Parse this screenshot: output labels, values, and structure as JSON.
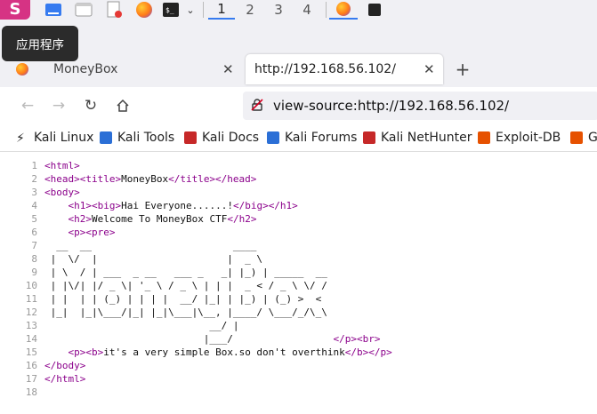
{
  "taskbar": {
    "workspaces": [
      "1",
      "2",
      "3",
      "4"
    ],
    "active_workspace": "1",
    "tooltip": "应用程序"
  },
  "tabs": [
    {
      "title": "MoneyBox",
      "active": false
    },
    {
      "title": "http://192.168.56.102/",
      "active": true
    }
  ],
  "new_tab_label": "+",
  "urlbar": {
    "value": "view-source:http://192.168.56.102/"
  },
  "bookmarks": [
    {
      "label": "Kali Linux",
      "color": "#1e1e1e"
    },
    {
      "label": "Kali Tools",
      "color": "#2b6fd6"
    },
    {
      "label": "Kali Docs",
      "color": "#c62828"
    },
    {
      "label": "Kali Forums",
      "color": "#2b6fd6"
    },
    {
      "label": "Kali NetHunter",
      "color": "#c62828"
    },
    {
      "label": "Exploit-DB",
      "color": "#e65100"
    },
    {
      "label": "G",
      "color": "#e65100"
    }
  ],
  "source_lines": [
    {
      "n": "1",
      "tokens": [
        {
          "t": "tag",
          "v": "<html>"
        }
      ]
    },
    {
      "n": "2",
      "tokens": [
        {
          "t": "tag",
          "v": "<head><title>"
        },
        {
          "t": "txt",
          "v": "MoneyBox"
        },
        {
          "t": "tag",
          "v": "</title></head>"
        }
      ]
    },
    {
      "n": "3",
      "tokens": [
        {
          "t": "tag",
          "v": "<body>"
        }
      ]
    },
    {
      "n": "4",
      "tokens": [
        {
          "t": "txt",
          "v": "    "
        },
        {
          "t": "tag",
          "v": "<h1><big>"
        },
        {
          "t": "txt",
          "v": "Hai Everyone......!"
        },
        {
          "t": "tag",
          "v": "</big></h1>"
        }
      ]
    },
    {
      "n": "5",
      "tokens": [
        {
          "t": "txt",
          "v": "    "
        },
        {
          "t": "tag",
          "v": "<h2>"
        },
        {
          "t": "txt",
          "v": "Welcome To MoneyBox CTF"
        },
        {
          "t": "tag",
          "v": "</h2>"
        }
      ]
    },
    {
      "n": "6",
      "tokens": [
        {
          "t": "txt",
          "v": "    "
        },
        {
          "t": "tag",
          "v": "<p><pre>"
        }
      ]
    },
    {
      "n": "7",
      "tokens": [
        {
          "t": "txt",
          "v": "  __  __                        ____"
        }
      ]
    },
    {
      "n": "8",
      "tokens": [
        {
          "t": "txt",
          "v": " |  \\/  |                      |  _ \\"
        }
      ]
    },
    {
      "n": "9",
      "tokens": [
        {
          "t": "txt",
          "v": " | \\  / | ___  _ __   ___ _   _| |_) | _____  __"
        }
      ]
    },
    {
      "n": "10",
      "tokens": [
        {
          "t": "txt",
          "v": " | |\\/| |/ _ \\| '_ \\ / _ \\ | | |  _ < / _ \\ \\/ /"
        }
      ]
    },
    {
      "n": "11",
      "tokens": [
        {
          "t": "txt",
          "v": " | |  | | (_) | | | |  __/ |_| | |_) | (_) >  <"
        }
      ]
    },
    {
      "n": "12",
      "tokens": [
        {
          "t": "txt",
          "v": " |_|  |_|\\___/|_| |_|\\___|\\__, |____/ \\___/_/\\_\\"
        }
      ]
    },
    {
      "n": "13",
      "tokens": [
        {
          "t": "txt",
          "v": "                            __/ |"
        }
      ]
    },
    {
      "n": "14",
      "tokens": [
        {
          "t": "txt",
          "v": "                           |___/                 "
        },
        {
          "t": "tag",
          "v": "</p><br>"
        }
      ]
    },
    {
      "n": "15",
      "tokens": [
        {
          "t": "txt",
          "v": "    "
        },
        {
          "t": "tag",
          "v": "<p><b>"
        },
        {
          "t": "txt",
          "v": "it's a very simple Box.so don't overthink"
        },
        {
          "t": "tag",
          "v": "</b></p>"
        }
      ]
    },
    {
      "n": "16",
      "tokens": [
        {
          "t": "tag",
          "v": "</body>"
        }
      ]
    },
    {
      "n": "17",
      "tokens": [
        {
          "t": "tag",
          "v": "</html>"
        }
      ]
    },
    {
      "n": "18",
      "tokens": []
    }
  ]
}
